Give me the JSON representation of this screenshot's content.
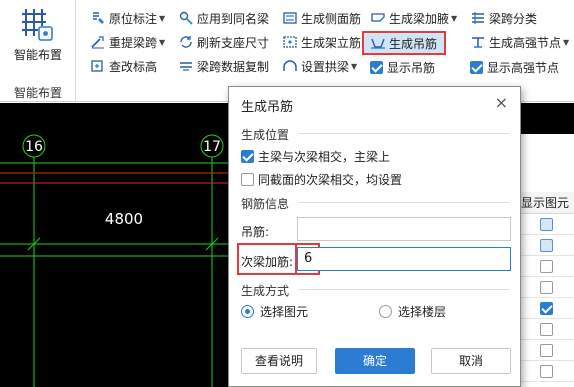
{
  "ribbon": {
    "smart_layout": {
      "button_label": "智能布置",
      "group_label": "智能布置"
    },
    "rows": [
      [
        "原位标注",
        "应用到同名梁",
        "生成侧面筋",
        "生成梁加腋",
        "梁跨分类"
      ],
      [
        "重提梁跨",
        "刷新支座尺寸",
        "生成架立筋",
        "生成吊筋",
        "生成高强节点"
      ],
      [
        "查改标高",
        "梁跨数据复制",
        "设置拱梁",
        "显示吊筋",
        "显示高强节点"
      ]
    ]
  },
  "canvas": {
    "axis_labels": [
      "16",
      "17"
    ],
    "dimension": "4800",
    "colors": {
      "background": "#000000",
      "grid": "#1fd11f",
      "red_line": "#d92b2b",
      "text": "#ffffff"
    }
  },
  "right_panel": {
    "header": "显示图元"
  },
  "dialog": {
    "title": "生成吊筋",
    "close_icon": "×",
    "position_section": "生成位置",
    "position_options": [
      "主梁与次梁相交，主梁上",
      "同截面的次梁相交，均设置"
    ],
    "rebar_section": "钢筋信息",
    "hanger_label": "吊筋:",
    "hanger_value": "",
    "secondary_label": "次梁加筋:",
    "secondary_value": "6",
    "method_section": "生成方式",
    "method_options": [
      "选择图元",
      "选择楼层"
    ],
    "buttons": {
      "help": "查看说明",
      "ok": "确定",
      "cancel": "取消"
    }
  },
  "colors": {
    "accent": "#2b7cd3",
    "highlight": "#e23b3b"
  }
}
